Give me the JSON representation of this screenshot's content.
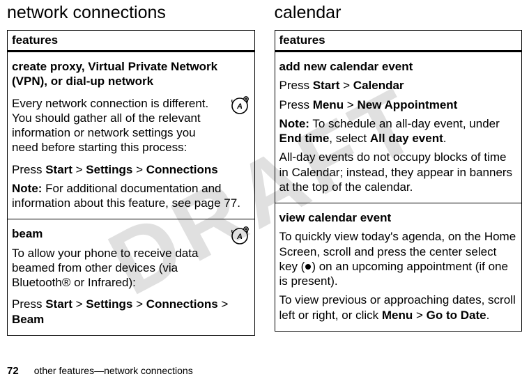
{
  "watermark": "DRAFT",
  "left": {
    "title": "network connections",
    "header": "features",
    "rows": [
      {
        "heading": "create proxy, Virtual Private Network (VPN), or dial-up network",
        "intro": "Every network connection is different. You should gather all of the relevant information or network settings you need before starting this process:",
        "press_prefix": "Press ",
        "path1": "Start",
        "gt1": " > ",
        "path2": "Settings",
        "gt2": " > ",
        "path3": "Connections",
        "note_label": "Note:",
        "note_text": " For additional documentation and information about this feature, see page 77."
      },
      {
        "heading": "beam",
        "intro": "To allow your phone to receive data beamed from other devices (via Bluetooth® or Infrared):",
        "press_prefix": "Press ",
        "path1": "Start",
        "gt1": " > ",
        "path2": "Settings",
        "gt2": " > ",
        "path3": "Connections",
        "gt3": " > ",
        "path4": "Beam"
      }
    ]
  },
  "right": {
    "title": "calendar",
    "header": "features",
    "rows": [
      {
        "heading": "add new calendar event",
        "press1_prefix": "Press ",
        "p1a": "Start",
        "gt1": " > ",
        "p1b": "Calendar",
        "press2_prefix": "Press ",
        "p2a": "Menu",
        "gt2": " > ",
        "p2b": "New Appointment",
        "note_label": "Note:",
        "note_text1": " To schedule an all-day event, under ",
        "note_cond1": "End time",
        "note_text2": ", select ",
        "note_cond2": "All day event",
        "note_text3": ".",
        "tail": "All-day events do not occupy blocks of time in Calendar; instead, they appear in banners at the top of the calendar."
      },
      {
        "heading": "view calendar event",
        "intro1": "To quickly view today's agenda, on the Home Screen, scroll and press the center select key (",
        "intro2": ") on an upcoming appointment (if one is present).",
        "tail1": "To view previous or approaching dates, scroll left or right, or click ",
        "t1": "Menu",
        "gt": " > ",
        "t2": "Go to Date",
        "tail2": "."
      }
    ]
  },
  "footer": {
    "page": "72",
    "text": "other features—network connections"
  }
}
